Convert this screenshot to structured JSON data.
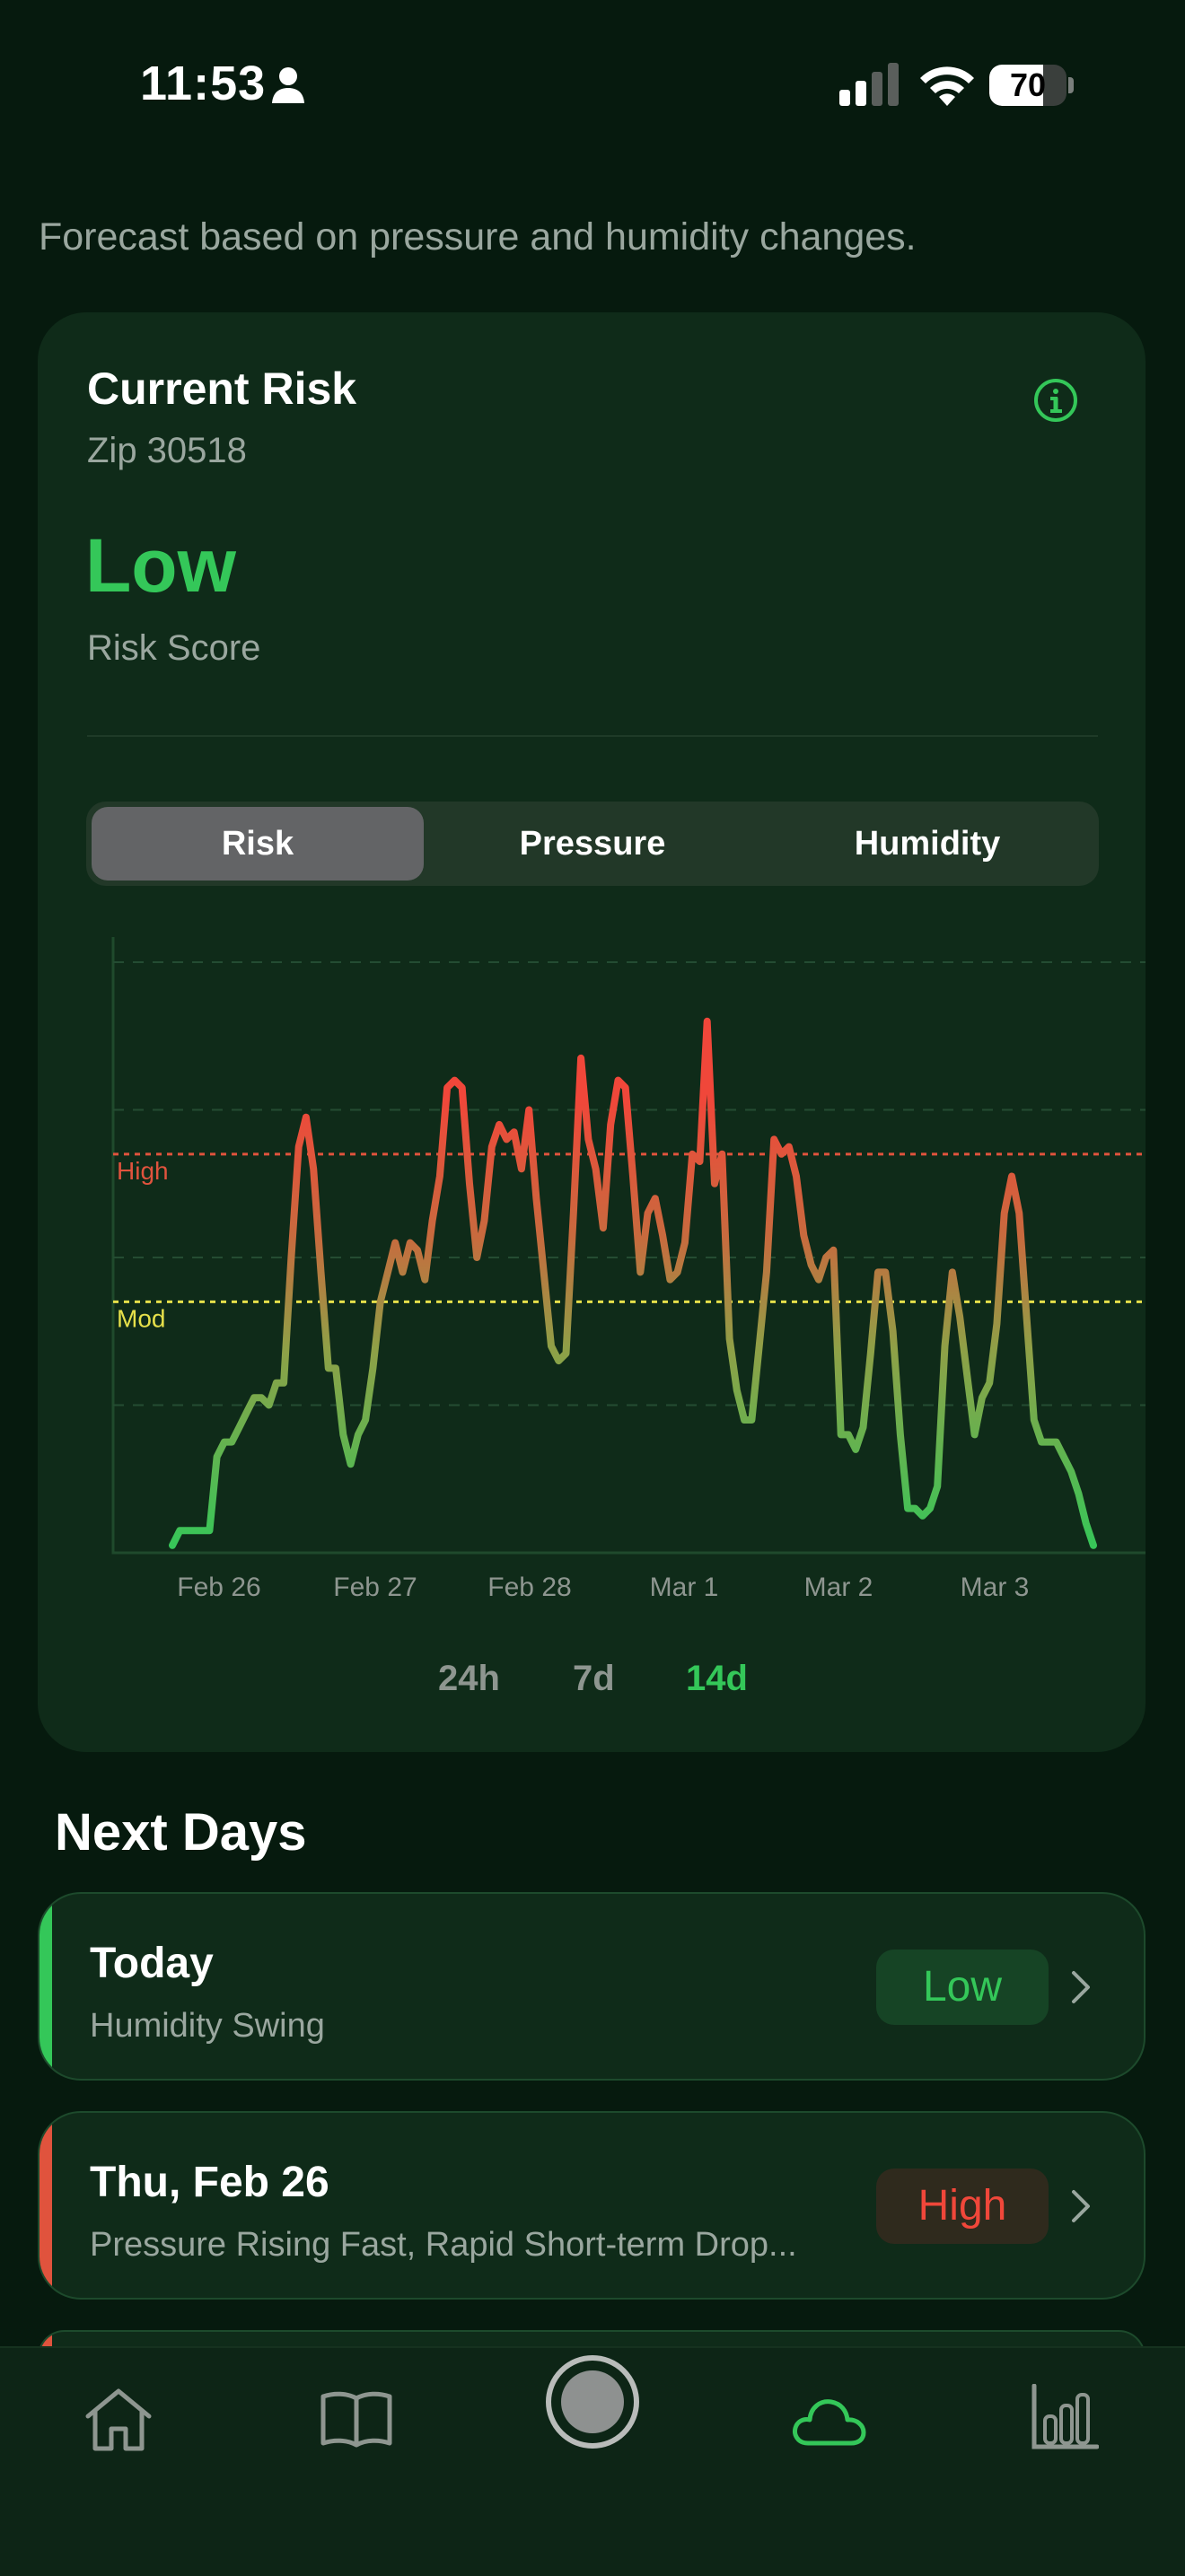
{
  "status_bar": {
    "time": "11:53",
    "battery_level": "70",
    "battery_fraction": 0.7
  },
  "subtitle": "Forecast based on pressure and humidity changes.",
  "risk_card": {
    "title": "Current Risk",
    "zip": "Zip 30518",
    "level": "Low",
    "level_caption": "Risk Score",
    "tabs": [
      "Risk",
      "Pressure",
      "Humidity"
    ],
    "active_tab": "Risk",
    "ranges": [
      "24h",
      "7d",
      "14d"
    ],
    "active_range": "14d"
  },
  "chart_data": {
    "type": "line",
    "x_tick_labels": [
      "Feb 26",
      "Feb 27",
      "Feb 28",
      "Mar 1",
      "Mar 2",
      "Mar 3"
    ],
    "threshold_labels": [
      "High",
      "Mod"
    ],
    "threshold_colors": {
      "High": "#e0533d",
      "Mod": "#e6e04a"
    },
    "grid": true,
    "series": [
      {
        "values": [
          0.1,
          0.3,
          0.3,
          0.3,
          0.3,
          0.3,
          1.3,
          1.5,
          1.5,
          1.7,
          1.9,
          2.1,
          2.1,
          2.0,
          2.3,
          2.3,
          4.0,
          5.5,
          5.9,
          5.2,
          3.8,
          2.5,
          2.5,
          1.6,
          1.2,
          1.6,
          1.8,
          2.5,
          3.4,
          3.8,
          4.2,
          3.8,
          4.2,
          4.1,
          3.7,
          4.5,
          5.1,
          6.3,
          6.4,
          6.3,
          5.0,
          4.0,
          4.5,
          5.5,
          5.8,
          5.6,
          5.7,
          5.2,
          6.0,
          4.8,
          3.8,
          2.8,
          2.6,
          2.7,
          4.6,
          6.7,
          5.6,
          5.2,
          4.4,
          5.8,
          6.4,
          6.3,
          5.1,
          3.8,
          4.6,
          4.8,
          4.3,
          3.7,
          3.8,
          4.2,
          5.4,
          5.3,
          7.2,
          5.0,
          5.4,
          2.9,
          2.2,
          1.8,
          1.8,
          2.8,
          3.8,
          5.6,
          5.4,
          5.5,
          5.1,
          4.3,
          3.9,
          3.7,
          4.0,
          4.1,
          1.6,
          1.6,
          1.4,
          1.7,
          2.7,
          3.8,
          3.8,
          3.0,
          1.6,
          0.6,
          0.6,
          0.5,
          0.6,
          0.9,
          2.8,
          3.8,
          3.2,
          2.4,
          1.6,
          2.1,
          2.3,
          3.1,
          4.6,
          5.1,
          4.6,
          3.2,
          1.8,
          1.5,
          1.5,
          1.5,
          1.3,
          1.1,
          0.8,
          0.4,
          0.1
        ]
      }
    ]
  },
  "next_days": {
    "title": "Next Days",
    "items": [
      {
        "name": "Today",
        "reason": "Humidity Swing",
        "level": "Low",
        "accent": "#34c759",
        "badge_bg": "#164425",
        "badge_fg": "#34c759"
      },
      {
        "name": "Thu, Feb 26",
        "reason": "Pressure Rising Fast, Rapid Short-term Drop...",
        "level": "High",
        "accent": "#e0533d",
        "badge_bg": "#2f2a1d",
        "badge_fg": "#f0473a"
      }
    ]
  },
  "tab_bar": {
    "icons": [
      "home-icon",
      "book-icon",
      "record-icon",
      "cloud-icon",
      "bar-chart-icon"
    ],
    "active": "cloud-icon"
  },
  "colors": {
    "accent": "#34c759",
    "high": "#e0533d",
    "mod": "#e6e04a",
    "background": "#061a0e",
    "card": "#0f2b19"
  }
}
